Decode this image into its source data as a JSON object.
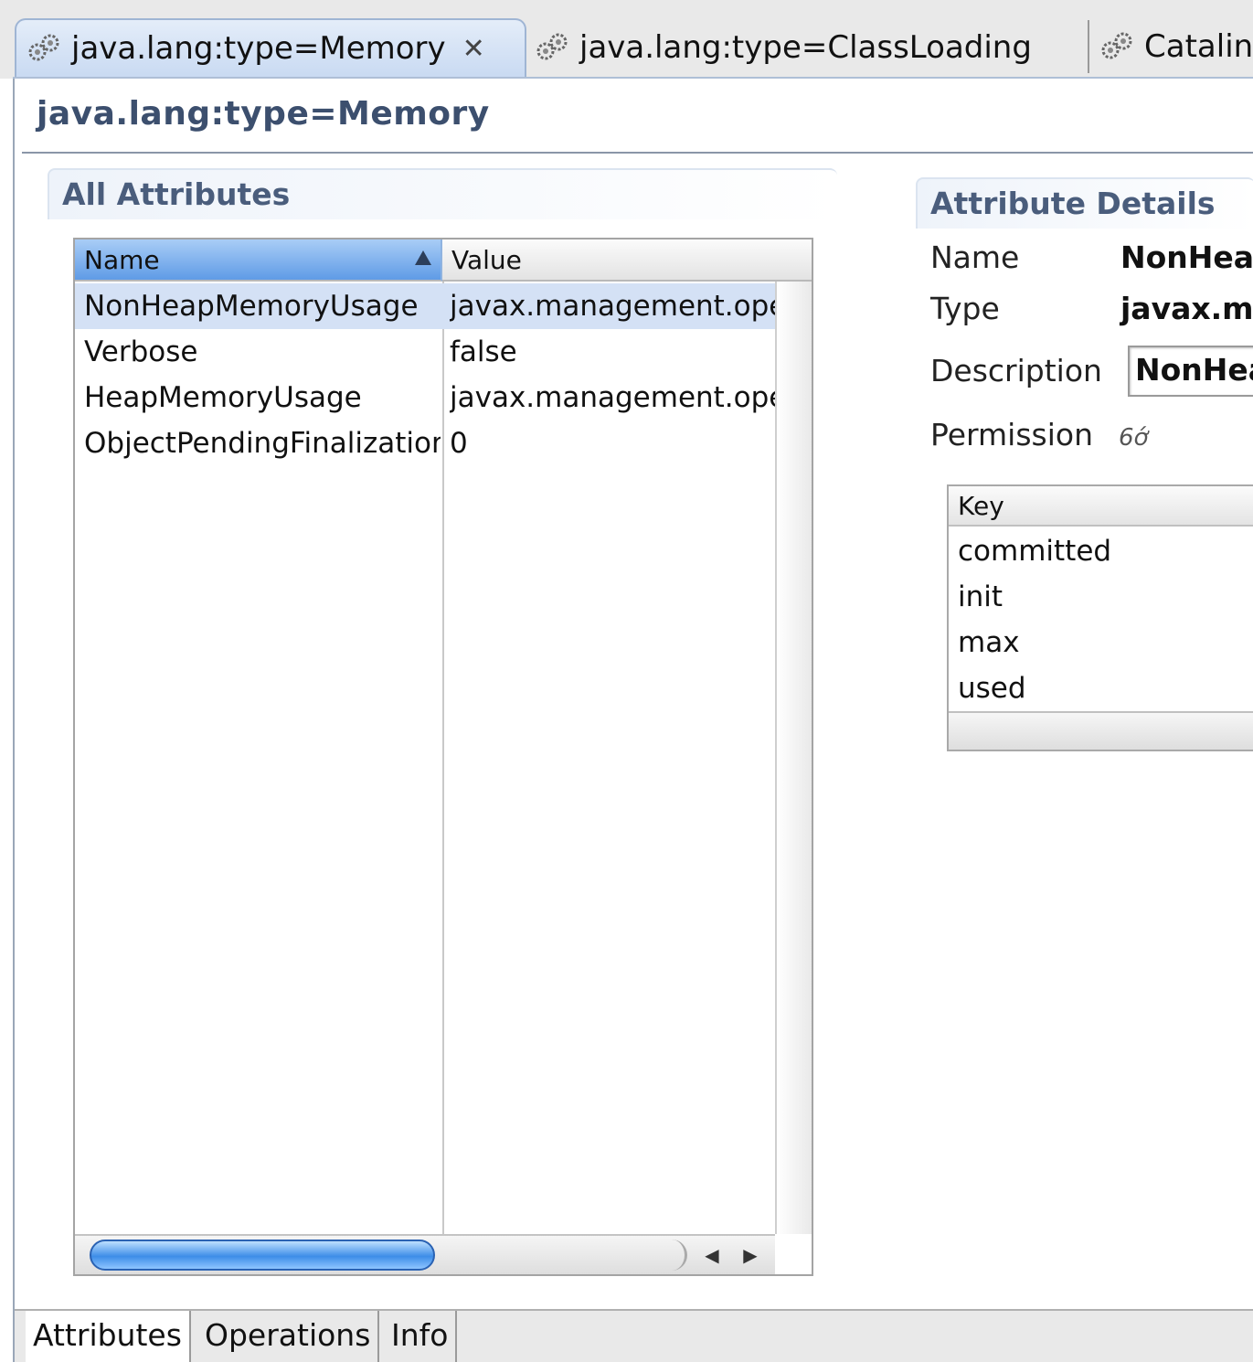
{
  "tabs": [
    {
      "label": "java.lang:type=Memory",
      "icon": "gears-icon",
      "active": true,
      "close_label": "✕"
    },
    {
      "label": "java.lang:type=ClassLoading",
      "icon": "gears-icon",
      "active": false
    },
    {
      "label": "Catalin",
      "icon": "gears-icon",
      "active": false
    }
  ],
  "header": {
    "title": "java.lang:type=Memory"
  },
  "all_attributes": {
    "title": "All Attributes",
    "columns": [
      "Name",
      "Value"
    ],
    "rows": [
      {
        "name": "NonHeapMemoryUsage",
        "value": "javax.management.ope"
      },
      {
        "name": "Verbose",
        "value": "false"
      },
      {
        "name": "HeapMemoryUsage",
        "value": "javax.management.ope"
      },
      {
        "name": "ObjectPendingFinalizatior",
        "value": "0"
      }
    ],
    "selected_row": 0,
    "scroll_left": "◀",
    "scroll_right": "▶"
  },
  "attribute_details": {
    "title": "Attribute Details",
    "name_label": "Name",
    "name_value": "NonHeap",
    "type_label": "Type",
    "type_value": "javax.ma",
    "description_label": "Description",
    "description_value": "NonHea",
    "permission_label": "Permission",
    "permission_icon": "glasses-icon",
    "permission_glyph": "6ớ",
    "table": {
      "column": "Key",
      "rows": [
        "committed",
        "init",
        "max",
        "used"
      ]
    }
  },
  "page_tabs": [
    "Attributes",
    "Operations",
    "Info"
  ],
  "colors": {
    "accent": "#5f9be6",
    "selected_row": "#d4e1f5",
    "header_text": "#3c4f6e"
  }
}
